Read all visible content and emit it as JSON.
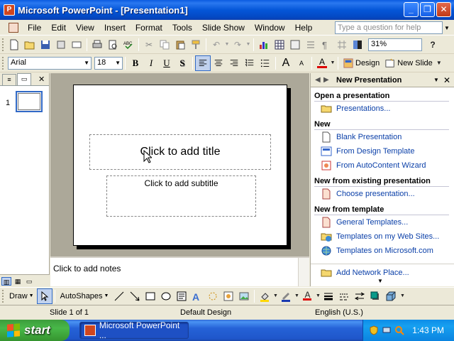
{
  "window": {
    "title": "Microsoft PowerPoint - [Presentation1]",
    "app_icon_letter": "P",
    "buttons": {
      "minimize": "_",
      "restore": "❐",
      "close": "✕"
    }
  },
  "menu": {
    "items": [
      "File",
      "Edit",
      "View",
      "Insert",
      "Format",
      "Tools",
      "Slide Show",
      "Window",
      "Help"
    ],
    "help_placeholder": "Type a question for help"
  },
  "standard_toolbar": {
    "zoom": "31%"
  },
  "formatting_toolbar": {
    "font": "Arial",
    "size": "18",
    "design_label": "Design",
    "new_slide_label": "New Slide"
  },
  "left_pane": {
    "slide_number": "1"
  },
  "slide": {
    "title_placeholder": "Click to add title",
    "subtitle_placeholder": "Click to add subtitle"
  },
  "notes": {
    "placeholder": "Click to add notes"
  },
  "task_pane": {
    "title": "New Presentation",
    "sections": [
      {
        "heading": "Open a presentation",
        "links": [
          "Presentations..."
        ]
      },
      {
        "heading": "New",
        "links": [
          "Blank Presentation",
          "From Design Template",
          "From AutoContent Wizard"
        ]
      },
      {
        "heading": "New from existing presentation",
        "links": [
          "Choose presentation..."
        ]
      },
      {
        "heading": "New from template",
        "links": [
          "General Templates...",
          "Templates on my Web Sites...",
          "Templates on Microsoft.com"
        ]
      }
    ],
    "bottom_link": "Add Network Place..."
  },
  "drawing_toolbar": {
    "draw_label": "Draw",
    "autoshapes_label": "AutoShapes"
  },
  "status_bar": {
    "slide": "Slide 1 of 1",
    "design": "Default Design",
    "language": "English (U.S.)"
  },
  "taskbar": {
    "start_label": "start",
    "task_item": "Microsoft PowerPoint ...",
    "clock": "1:43 PM"
  }
}
